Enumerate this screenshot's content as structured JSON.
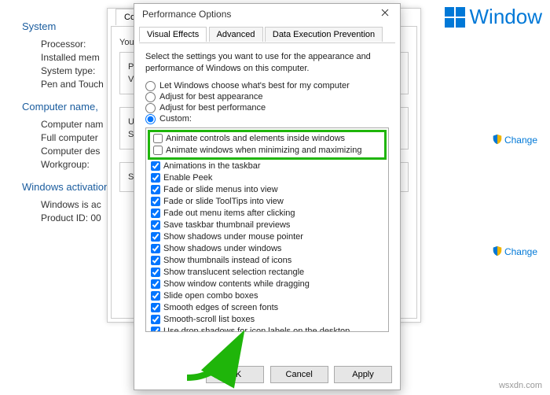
{
  "win_brand": "Window",
  "sys": {
    "title1": "System",
    "rows1": [
      "Processor:",
      "Installed mem",
      "System type:",
      "Pen and Touch"
    ],
    "title2": "Computer name,",
    "rows2": [
      "Computer nam",
      "Full computer",
      "Computer des",
      "Workgroup:"
    ],
    "title3": "Windows activation",
    "rows3": [
      "Windows is ac",
      "Product ID:  00"
    ],
    "link_change": "Change"
  },
  "mid": {
    "tab": "Compu",
    "you": "You",
    "grp1_t": "Per",
    "grp1_b": "Vis",
    "grp2_t": "Use",
    "grp2_b": "Sys",
    "grp3_t": "Sys"
  },
  "perf": {
    "title": "Performance Options",
    "tabs": [
      "Visual Effects",
      "Advanced",
      "Data Execution Prevention"
    ],
    "desc": "Select the settings you want to use for the appearance and performance of Windows on this computer.",
    "radios": [
      "Let Windows choose what's best for my computer",
      "Adjust for best appearance",
      "Adjust for best performance",
      "Custom:"
    ],
    "selected_radio": 3,
    "highlighted": [
      "Animate controls and elements inside windows",
      "Animate windows when minimizing and maximizing"
    ],
    "options": [
      "Animations in the taskbar",
      "Enable Peek",
      "Fade or slide menus into view",
      "Fade or slide ToolTips into view",
      "Fade out menu items after clicking",
      "Save taskbar thumbnail previews",
      "Show shadows under mouse pointer",
      "Show shadows under windows",
      "Show thumbnails instead of icons",
      "Show translucent selection rectangle",
      "Show window contents while dragging",
      "Slide open combo boxes",
      "Smooth edges of screen fonts",
      "Smooth-scroll list boxes",
      "Use drop shadows for icon labels on the desktop"
    ],
    "buttons": {
      "ok": "OK",
      "cancel": "Cancel",
      "apply": "Apply"
    }
  },
  "watermark": "wsxdn.com"
}
